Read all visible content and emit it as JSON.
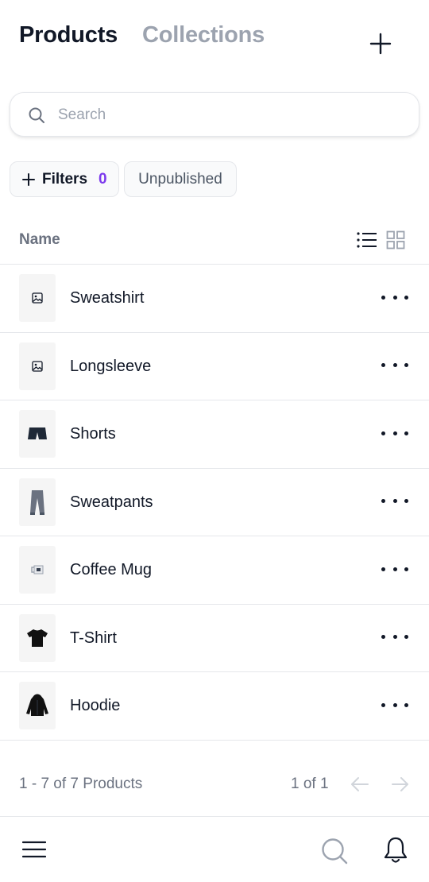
{
  "header": {
    "tabs": [
      {
        "label": "Products",
        "active": true
      },
      {
        "label": "Collections",
        "active": false
      }
    ],
    "add_icon": "plus-icon"
  },
  "search": {
    "placeholder": "Search",
    "value": "",
    "icon": "search-icon"
  },
  "filters": {
    "filters_label": "Filters",
    "filters_count": "0",
    "unpublished_label": "Unpublished",
    "accent_color": "#7c3aed"
  },
  "list": {
    "column_name": "Name",
    "view_modes": [
      "list-view-icon",
      "grid-view-icon"
    ],
    "items": [
      {
        "title": "Sweatshirt",
        "thumb": "image-placeholder-icon"
      },
      {
        "title": "Longsleeve",
        "thumb": "image-placeholder-icon"
      },
      {
        "title": "Shorts",
        "thumb": "shorts-image"
      },
      {
        "title": "Sweatpants",
        "thumb": "sweatpants-image"
      },
      {
        "title": "Coffee Mug",
        "thumb": "mug-image"
      },
      {
        "title": "T-Shirt",
        "thumb": "tshirt-image"
      },
      {
        "title": "Hoodie",
        "thumb": "hoodie-image"
      }
    ]
  },
  "pagination": {
    "count_text": "1 - 7 of 7 Products",
    "page_text": "1 of 1"
  },
  "bottom_nav": {
    "icons": [
      "menu-icon",
      "search-icon",
      "bell-icon"
    ]
  }
}
